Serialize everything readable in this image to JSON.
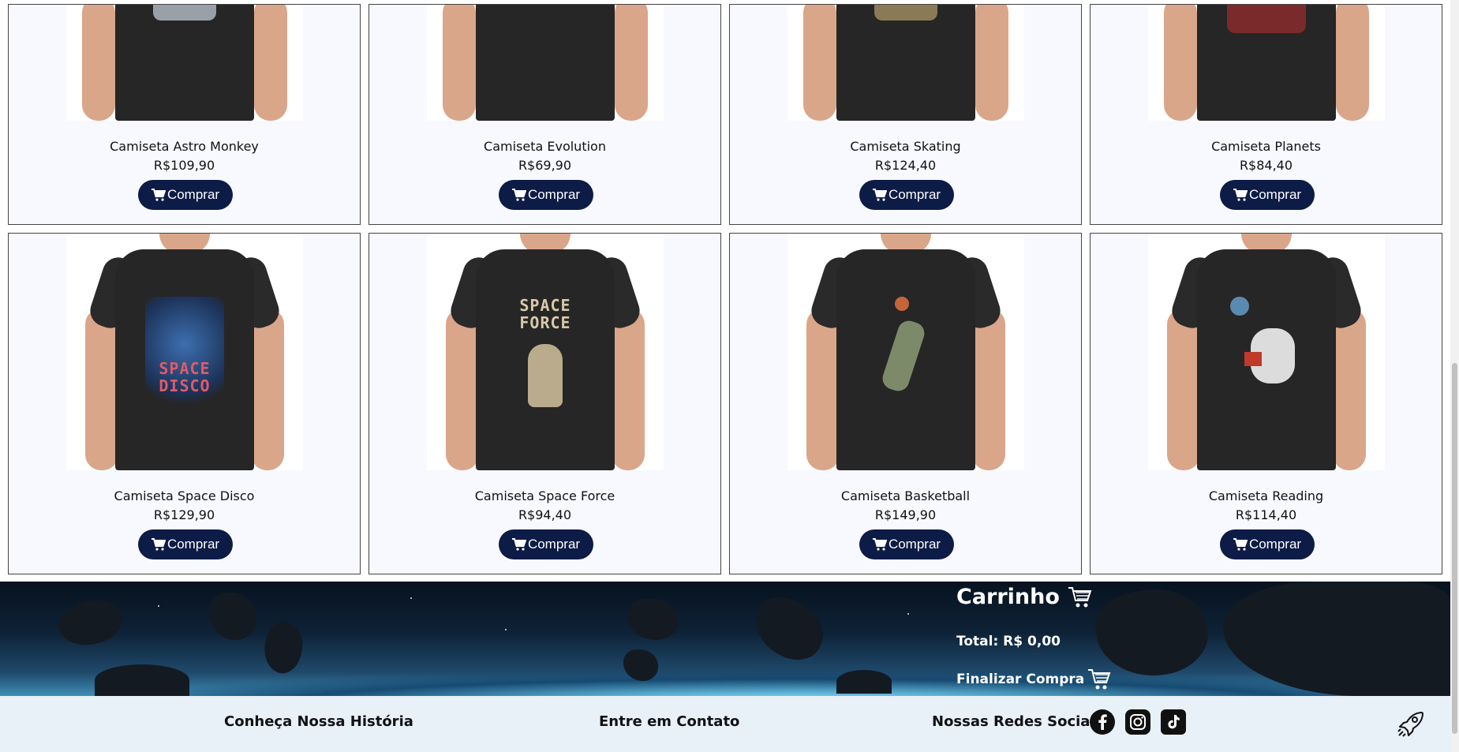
{
  "products_top": [
    {
      "name": "Camiseta Astro Monkey",
      "price": "R$109,90"
    },
    {
      "name": "Camiseta Evolution",
      "price": "R$69,90"
    },
    {
      "name": "Camiseta Skating",
      "price": "R$124,40"
    },
    {
      "name": "Camiseta Planets",
      "price": "R$84,40"
    }
  ],
  "products_bottom": [
    {
      "name": "Camiseta Space Disco",
      "price": "R$129,90",
      "print_text": "SPACE DISCO"
    },
    {
      "name": "Camiseta Space Force",
      "price": "R$94,40",
      "print_text": "SPACE FORCE"
    },
    {
      "name": "Camiseta Basketball",
      "price": "R$149,90"
    },
    {
      "name": "Camiseta Reading",
      "price": "R$114,40"
    }
  ],
  "buy_label": "Comprar",
  "cart": {
    "title": "Carrinho",
    "total": "Total: R$ 0,00",
    "checkout": "Finalizar Compra"
  },
  "footer": {
    "history": "Conheça Nossa História",
    "contact": "Entre em Contato",
    "social": "Nossas Redes Sociais"
  },
  "icons": {
    "cart": "cart-icon",
    "facebook": "facebook-icon",
    "instagram": "instagram-icon",
    "tiktok": "tiktok-icon",
    "rocket": "rocket-icon"
  },
  "colors": {
    "button": "#0d1c46",
    "card_bg": "#f7f9fe",
    "footer_bg": "#e8f0f8"
  }
}
